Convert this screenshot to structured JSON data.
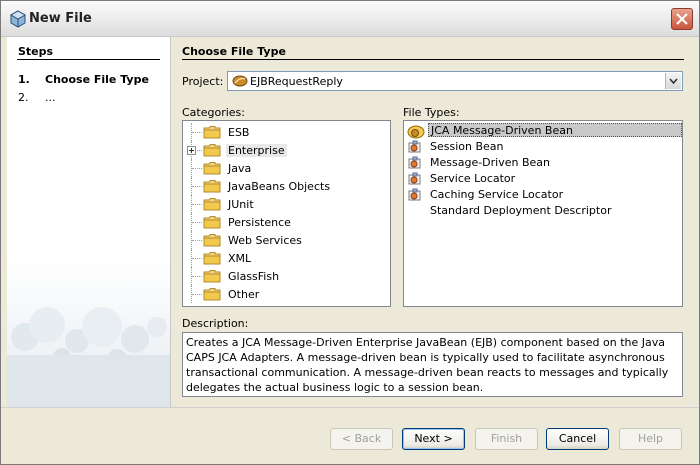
{
  "window": {
    "title": "New File"
  },
  "steps": {
    "heading": "Steps",
    "items": [
      {
        "num": "1.",
        "label": "Choose File Type"
      },
      {
        "num": "2.",
        "label": "..."
      }
    ]
  },
  "main": {
    "heading": "Choose File Type",
    "project_label": "Project:",
    "project_value": "EJBRequestReply",
    "categories_label": "Categories:",
    "file_types_label": "File Types:",
    "categories": [
      {
        "label": "ESB"
      },
      {
        "label": "Enterprise"
      },
      {
        "label": "Java"
      },
      {
        "label": "JavaBeans Objects"
      },
      {
        "label": "JUnit"
      },
      {
        "label": "Persistence"
      },
      {
        "label": "Web Services"
      },
      {
        "label": "XML"
      },
      {
        "label": "GlassFish"
      },
      {
        "label": "Other"
      }
    ],
    "selected_category": "Enterprise",
    "file_types": [
      {
        "label": "JCA Message-Driven Bean"
      },
      {
        "label": "Session Bean"
      },
      {
        "label": "Message-Driven Bean"
      },
      {
        "label": "Service Locator"
      },
      {
        "label": "Caching Service Locator"
      },
      {
        "label": "Standard Deployment Descriptor"
      }
    ],
    "selected_file_type": "JCA Message-Driven Bean",
    "description_label": "Description:",
    "description": "Creates a JCA Message-Driven Enterprise JavaBean (EJB) component based on the Java CAPS JCA Adapters. A message-driven bean is typically used to facilitate asynchronous transactional communication. A message-driven bean reacts to messages and typically delegates the actual business logic to a session bean."
  },
  "buttons": {
    "back": "< Back",
    "next": "Next >",
    "finish": "Finish",
    "cancel": "Cancel",
    "help": "Help"
  },
  "colors": {
    "dialog_bg": "#ece9d8",
    "selection_bg": "#c9c9c9",
    "folder": "#f2c94c"
  }
}
